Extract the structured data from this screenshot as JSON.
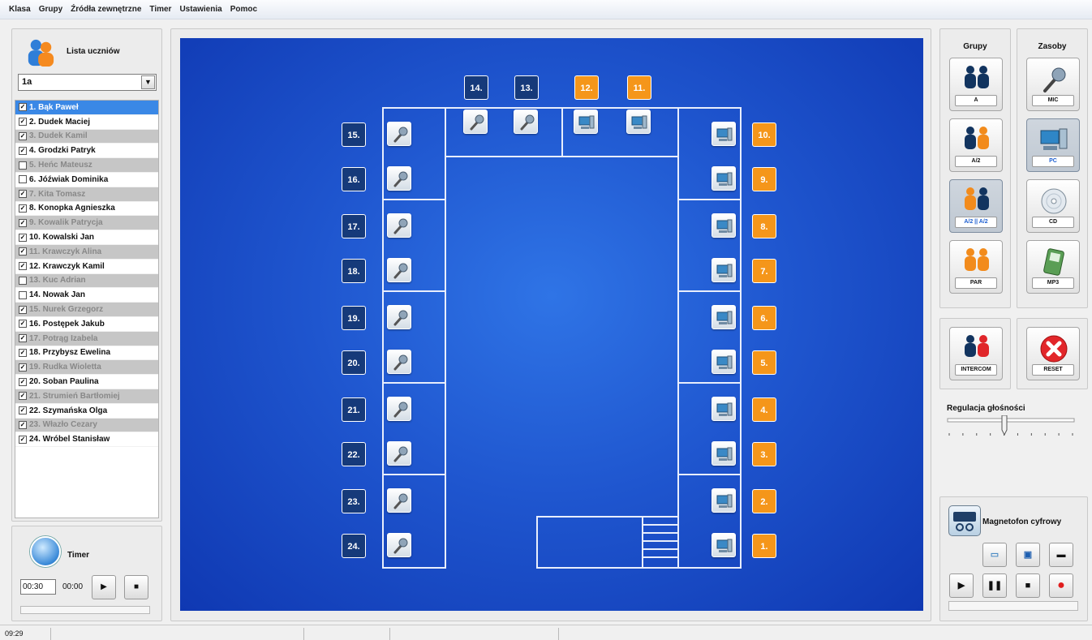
{
  "menu": [
    "Klasa",
    "Grupy",
    "Źródła zewnętrzne",
    "Timer",
    "Ustawienia",
    "Pomoc"
  ],
  "students": {
    "title": "Lista uczniów",
    "class_value": "1a",
    "items": [
      {
        "label": "1. Bąk Paweł",
        "checked": true,
        "absent": false,
        "selected": true
      },
      {
        "label": "2. Dudek Maciej",
        "checked": true,
        "absent": false
      },
      {
        "label": "3. Dudek Kamil",
        "checked": true,
        "absent": true
      },
      {
        "label": "4. Grodzki Patryk",
        "checked": true,
        "absent": false
      },
      {
        "label": "5. Heńc Mateusz",
        "checked": false,
        "absent": true
      },
      {
        "label": "6. Jóźwiak Dominika",
        "checked": false,
        "absent": false
      },
      {
        "label": "7. Kita Tomasz",
        "checked": true,
        "absent": true
      },
      {
        "label": "8. Konopka Agnieszka",
        "checked": true,
        "absent": false
      },
      {
        "label": "9. Kowalik Patrycja",
        "checked": true,
        "absent": true
      },
      {
        "label": "10. Kowalski Jan",
        "checked": true,
        "absent": false
      },
      {
        "label": "11. Krawczyk Alina",
        "checked": true,
        "absent": true
      },
      {
        "label": "12. Krawczyk Kamil",
        "checked": true,
        "absent": false
      },
      {
        "label": "13. Kuc Adrian",
        "checked": false,
        "absent": true
      },
      {
        "label": "14. Nowak Jan",
        "checked": false,
        "absent": false
      },
      {
        "label": "15. Nurek Grzegorz",
        "checked": true,
        "absent": true
      },
      {
        "label": "16. Postępek Jakub",
        "checked": true,
        "absent": false
      },
      {
        "label": "17. Potrąg Izabela",
        "checked": true,
        "absent": true
      },
      {
        "label": "18. Przybysz Ewelina",
        "checked": true,
        "absent": false
      },
      {
        "label": "19. Rudka Wioletta",
        "checked": true,
        "absent": true
      },
      {
        "label": "20. Soban Paulina",
        "checked": true,
        "absent": false
      },
      {
        "label": "21. Strumień Bartłomiej",
        "checked": true,
        "absent": true
      },
      {
        "label": "22. Szymańska Olga",
        "checked": true,
        "absent": false
      },
      {
        "label": "23. Włazło Cezary",
        "checked": true,
        "absent": true
      },
      {
        "label": "24. Wróbel Stanisław",
        "checked": true,
        "absent": false
      }
    ]
  },
  "timer": {
    "title": "Timer",
    "input_value": "00:30",
    "remaining": "00:00",
    "play_icon": "play-icon",
    "stop_icon": "stop-icon"
  },
  "classroom": {
    "seats_left": [
      "15.",
      "16.",
      "17.",
      "18.",
      "19.",
      "20.",
      "21.",
      "22.",
      "23.",
      "24."
    ],
    "seats_right": [
      "10.",
      "9.",
      "8.",
      "7.",
      "6.",
      "5.",
      "4.",
      "3.",
      "2.",
      "1."
    ],
    "seats_top": [
      "14.",
      "13.",
      "12.",
      "11."
    ],
    "top_colors": [
      "blue",
      "blue",
      "orange",
      "orange"
    ],
    "colors": {
      "background": "#1f56cf",
      "seat_blue": "#163a7a",
      "seat_orange": "#f5961a",
      "lines": "#e8eefc"
    }
  },
  "groups": {
    "title": "Grupy",
    "buttons": [
      {
        "label": "A",
        "icon": "pair-navy-icon",
        "active": false
      },
      {
        "label": "A/2",
        "icon": "pair-navy-orange-icon",
        "active": false
      },
      {
        "label": "A/2 || A/2",
        "icon": "pair-orange-navy-icon",
        "active": true
      },
      {
        "label": "PAR",
        "icon": "pair-orange-icon",
        "active": false
      }
    ]
  },
  "resources": {
    "title": "Zasoby",
    "buttons": [
      {
        "label": "MIC",
        "icon": "microphone-icon",
        "active": false
      },
      {
        "label": "PC",
        "icon": "pc-icon",
        "active": true
      },
      {
        "label": "CD",
        "icon": "cd-icon",
        "active": false
      },
      {
        "label": "MP3",
        "icon": "mp3-player-icon",
        "active": false
      }
    ]
  },
  "intercom": {
    "label": "INTERCOM",
    "icon": "intercom-icon"
  },
  "reset": {
    "label": "RESET",
    "icon": "reset-icon"
  },
  "volume": {
    "title": "Regulacja głośności",
    "level": 0.45
  },
  "recorder": {
    "title": "Magnetofon cyfrowy",
    "buttons": [
      "open-folder-icon",
      "save-icon",
      "tape-icon",
      "play-icon",
      "pause-icon",
      "stop-icon",
      "record-icon"
    ]
  },
  "status": {
    "time": "09:29"
  }
}
